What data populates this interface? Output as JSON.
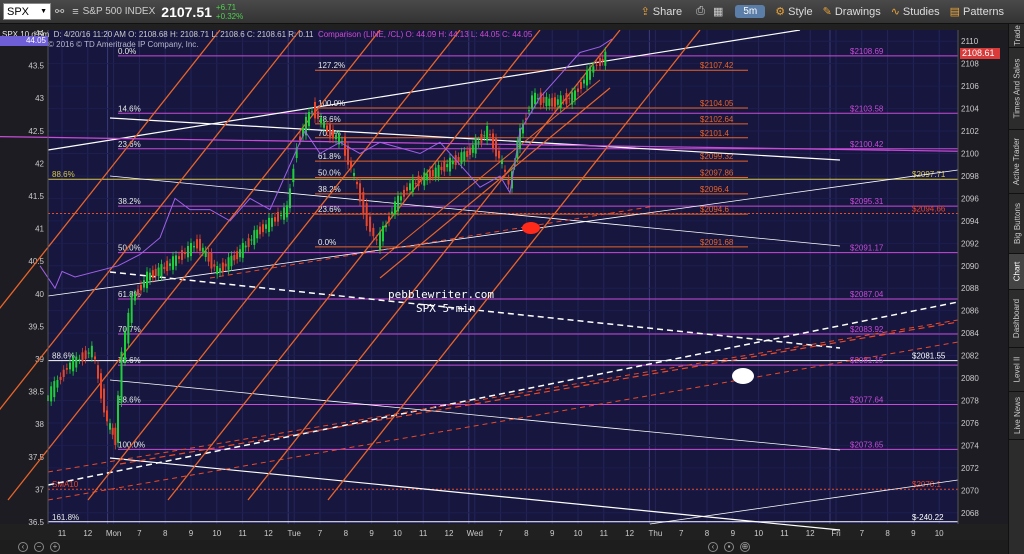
{
  "toolbar": {
    "symbol": "SPX",
    "instrument": "S&P 500 INDEX",
    "last_price": "2107.51",
    "change": "+6.71",
    "change_pct": "+0.32%",
    "share_label": "Share",
    "timeframe": "5m",
    "style_label": "Style",
    "drawings_label": "Drawings",
    "studies_label": "Studies",
    "patterns_label": "Patterns"
  },
  "chart_header": {
    "desc": "SPX 10 d 5m",
    "ohlc": "D: 4/20/16 11:20 AM  O: 2108.68  H: 2108.71  L: 2108.6  C: 2108.61  R: 0.11",
    "comparison": "Comparison (LINE, /CL)  O: 44.09  H: 44.13  L: 44.05  C: 44.05",
    "copyright": "© 2016 © TD Ameritrade IP Company, Inc.",
    "left_tag": "44.05",
    "current_price_tag": "2108.61"
  },
  "side_tabs": [
    "Trade",
    "Times And Sales",
    "Active Trader",
    "Big Buttons",
    "Chart",
    "Dashboard",
    "Level II",
    "Live News"
  ],
  "annotation": {
    "line1": "pebblewriter.com",
    "line2": "SPX 5-min"
  },
  "colors": {
    "background": "#16163e",
    "fib_magenta": "#c84cd8",
    "fib_orange": "#e8642a",
    "trend_red": "#e84a2a",
    "trend_white": "#ffffff",
    "candle_up": "#1ecf3a",
    "candle_down": "#e8462a",
    "crude_line": "#a060e8",
    "yellow_line": "#d8c84a"
  },
  "chart_data": {
    "type": "candlestick",
    "right_axis": {
      "ticks": [
        2068,
        2070,
        2072,
        2074,
        2076,
        2078,
        2080,
        2082,
        2084,
        2086,
        2088,
        2090,
        2092,
        2094,
        2096,
        2098,
        2100,
        2102,
        2104,
        2106,
        2108,
        2110
      ],
      "range": [
        2067,
        2111
      ]
    },
    "left_axis": {
      "ticks": [
        "36.5",
        "37",
        "37.5",
        "38",
        "38.5",
        "39",
        "39.5",
        "40",
        "40.5",
        "41",
        "41.5",
        "42",
        "42.5",
        "43",
        "43.5",
        "44"
      ]
    },
    "x_axis_labels": [
      "11",
      "12",
      "Mon",
      "7",
      "8",
      "9",
      "10",
      "11",
      "12",
      "Tue",
      "7",
      "8",
      "9",
      "10",
      "11",
      "12",
      "Wed",
      "7",
      "8",
      "9",
      "10",
      "11",
      "12",
      "Thu",
      "7",
      "8",
      "9",
      "10",
      "11",
      "12",
      "Fri",
      "7",
      "8",
      "9",
      "10"
    ],
    "horizontal_levels": [
      {
        "value": 2108.69,
        "label": "$2108.69",
        "color": "magenta",
        "fib": "0.0%"
      },
      {
        "value": 2107.42,
        "label": "$2107.42",
        "color": "orange",
        "fib": "127.2%"
      },
      {
        "value": 2104.05,
        "label": "$2104.05",
        "color": "orange",
        "fib": "100.0%"
      },
      {
        "value": 2103.58,
        "label": "$2103.58",
        "color": "magenta",
        "fib": "14.6%"
      },
      {
        "value": 2102.64,
        "label": "$2102.64",
        "color": "orange",
        "fib": "78.6%"
      },
      {
        "value": 2101.4,
        "label": "$2101.4",
        "color": "orange",
        "fib": "70.7%"
      },
      {
        "value": 2100.42,
        "label": "$2100.42",
        "color": "magenta",
        "fib": "23.6%"
      },
      {
        "value": 2099.32,
        "label": "$2099.32",
        "color": "orange",
        "fib": "61.8%"
      },
      {
        "value": 2097.86,
        "label": "$2097.86",
        "color": "orange",
        "fib": "50.0%"
      },
      {
        "value": 2097.71,
        "label": "$2097.71",
        "color": "yellow",
        "fib": "88.6%"
      },
      {
        "value": 2096.4,
        "label": "$2096.4",
        "color": "orange",
        "fib": "38.2%"
      },
      {
        "value": 2095.31,
        "label": "$2095.31",
        "color": "magenta",
        "fib": "38.2%"
      },
      {
        "value": 2094.6,
        "label": "$2094.6",
        "color": "orange",
        "fib": "23.6%"
      },
      {
        "value": 2094.66,
        "label": "$2094.66",
        "color": "red-dotted",
        "fib": ""
      },
      {
        "value": 2091.68,
        "label": "$2091.68",
        "color": "orange",
        "fib": "0.0%"
      },
      {
        "value": 2091.17,
        "label": "$2091.17",
        "color": "magenta",
        "fib": "50.0%"
      },
      {
        "value": 2087.04,
        "label": "$2087.04",
        "color": "magenta",
        "fib": "61.8%"
      },
      {
        "value": 2083.92,
        "label": "$2083.92",
        "color": "magenta",
        "fib": "70.7%"
      },
      {
        "value": 2081.55,
        "label": "$2081.55",
        "color": "white",
        "fib": "88.6%"
      },
      {
        "value": 2081.15,
        "label": "$2081.15",
        "color": "magenta",
        "fib": "78.6%"
      },
      {
        "value": 2077.64,
        "label": "$2077.64",
        "color": "magenta",
        "fib": "88.6%"
      },
      {
        "value": 2073.65,
        "label": "$2073.65",
        "color": "magenta",
        "fib": "100.0%"
      },
      {
        "value": 2070.1,
        "label": "$2070.1",
        "color": "red-dotted",
        "fib": "SMA10"
      },
      {
        "value": 2067.2,
        "label": "$-240.22",
        "color": "white",
        "fib": "161.8%"
      }
    ]
  }
}
